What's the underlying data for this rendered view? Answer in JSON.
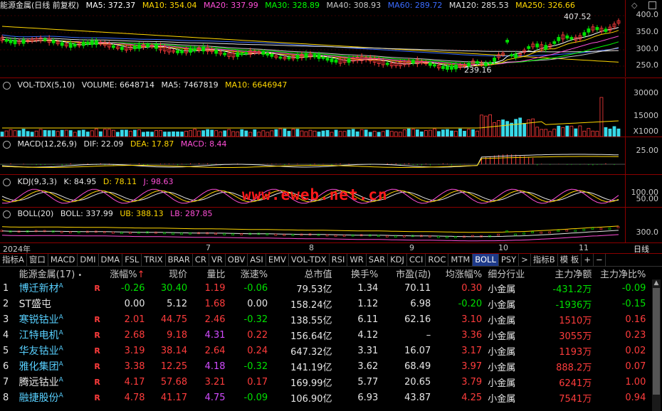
{
  "main_header": {
    "title": "能源金属(日线 前复权)",
    "ma5": "MA5: 372.37",
    "ma10": "MA10: 354.04",
    "ma20": "MA20: 337.99",
    "ma30": "MA30: 328.89",
    "ma40": "MA40: 308.93",
    "ma60": "MA60: 289.72",
    "ma120": "MA120: 285.53",
    "ma250": "MA250: 326.66"
  },
  "main_axis": [
    "400.0",
    "350.0",
    "300.0",
    "250.0"
  ],
  "annotations": {
    "high": "407.52",
    "low": "239.16"
  },
  "vol_header": {
    "title": "VOL-TDX(5,10)",
    "volume": "VOLUME: 6648714",
    "ma5": "MA5: 7467819",
    "ma10": "MA10: 6646947"
  },
  "vol_axis": [
    "30000",
    "15000",
    "X1000"
  ],
  "macd_header": {
    "title": "MACD(12,26,9)",
    "dif": "DIF: 22.09",
    "dea": "DEA: 17.87",
    "macd": "MACD: 8.44"
  },
  "macd_axis": [
    "25.00"
  ],
  "kdj_header": {
    "title": "KDJ(9,3,3)",
    "k": "K: 84.95",
    "d": "D: 78.11",
    "j": "J: 98.63"
  },
  "kdj_axis": [
    "100.00",
    "50.00"
  ],
  "boll_header": {
    "title": "BOLL(20)",
    "boll": "BOLL: 337.99",
    "ub": "UB: 388.13",
    "lb": "LB: 287.85"
  },
  "boll_axis": [
    "300.0"
  ],
  "date_axis": {
    "labels": [
      "2024年",
      "7",
      "8",
      "9",
      "10",
      "11"
    ],
    "period": "日线"
  },
  "watermark": "www.eweb.net.cn",
  "tabs": [
    "指标A",
    "窗口",
    "MACD",
    "DMI",
    "DMA",
    "FSL",
    "TRIX",
    "BRAR",
    "CR",
    "VR",
    "OBV",
    "ASI",
    "EMV",
    "VOL-TDX",
    "RSI",
    "WR",
    "SAR",
    "KDJ",
    "CCI",
    "ROC",
    "MTM",
    "BOLL",
    "PSY",
    ">",
    "指标B",
    "模 板",
    "+",
    "−"
  ],
  "table": {
    "headers": [
      "能源金属(17)",
      "涨幅%",
      "现价",
      "量比",
      "涨速%",
      "总市值",
      "换手%",
      "市盈(动)",
      "均涨幅%",
      "细分行业",
      "主力净额",
      "主力净比%"
    ],
    "rows": [
      {
        "no": "1",
        "name": "博迁新材",
        "pct": "-0.26",
        "price": "30.40",
        "vr": "1.19",
        "spd": "-0.06",
        "cap": "79.53亿",
        "turn": "1.34",
        "pe": "70.11",
        "avg": "0.30",
        "ind": "小金属",
        "net": "-431.2万",
        "ratio": "-0.09"
      },
      {
        "no": "2",
        "name": "ST盛屯",
        "pct": "0.00",
        "price": "5.12",
        "vr": "1.68",
        "spd": "0.00",
        "cap": "158.24亿",
        "turn": "1.12",
        "pe": "6.98",
        "avg": "-0.20",
        "ind": "小金属",
        "net": "-1936万",
        "ratio": "-0.15"
      },
      {
        "no": "3",
        "name": "寒锐钴业",
        "pct": "2.01",
        "price": "44.75",
        "vr": "2.46",
        "spd": "-0.32",
        "cap": "138.55亿",
        "turn": "6.11",
        "pe": "62.16",
        "avg": "3.10",
        "ind": "小金属",
        "net": "1510万",
        "ratio": "0.16"
      },
      {
        "no": "4",
        "name": "江特电机",
        "pct": "2.68",
        "price": "9.18",
        "vr": "4.31",
        "spd": "0.22",
        "cap": "156.64亿",
        "turn": "4.12",
        "pe": "–",
        "avg": "3.36",
        "ind": "小金属",
        "net": "3055万",
        "ratio": "0.23"
      },
      {
        "no": "5",
        "name": "华友钴业",
        "pct": "3.19",
        "price": "38.14",
        "vr": "2.64",
        "spd": "0.24",
        "cap": "647.32亿",
        "turn": "3.31",
        "pe": "16.07",
        "avg": "3.17",
        "ind": "小金属",
        "net": "1193万",
        "ratio": "0.02"
      },
      {
        "no": "6",
        "name": "雅化集团",
        "pct": "3.38",
        "price": "12.25",
        "vr": "4.18",
        "spd": "-0.32",
        "cap": "141.19亿",
        "turn": "3.62",
        "pe": "68.49",
        "avg": "3.97",
        "ind": "小金属",
        "net": "888.2万",
        "ratio": "0.07"
      },
      {
        "no": "7",
        "name": "腾远钴业",
        "pct": "4.17",
        "price": "57.68",
        "vr": "3.21",
        "spd": "0.17",
        "cap": "169.99亿",
        "turn": "5.77",
        "pe": "20.65",
        "avg": "3.79",
        "ind": "小金属",
        "net": "6241万",
        "ratio": "1.00"
      },
      {
        "no": "8",
        "name": "融捷股份",
        "pct": "4.78",
        "price": "41.17",
        "vr": "4.75",
        "spd": "-0.09",
        "cap": "106.90亿",
        "turn": "6.93",
        "pe": "43.87",
        "avg": "4.25",
        "ind": "小金属",
        "net": "7541万",
        "ratio": "0.94"
      }
    ]
  },
  "colors": {
    "up": "#ff3c3c",
    "down": "#00e000",
    "ma5": "#ffffff",
    "ma10": "#ffd700",
    "ma20": "#ff4fd8",
    "ma30": "#00ff00",
    "ma40": "#c8c8c8",
    "ma60": "#3a6bff",
    "ma120": "#e0e0e0",
    "ma250": "#ffd700"
  }
}
